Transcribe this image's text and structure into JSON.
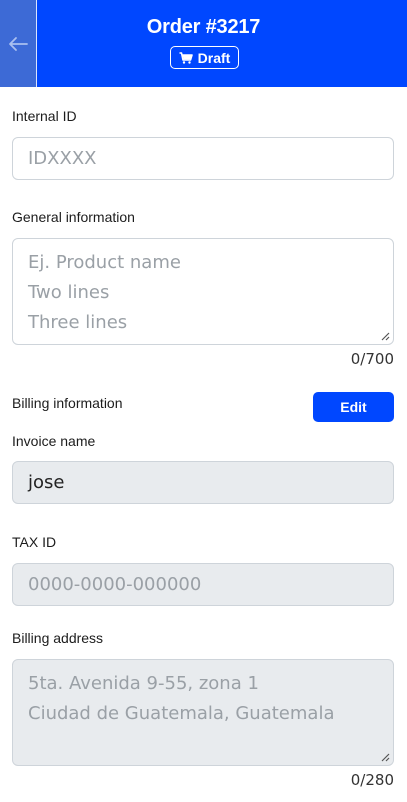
{
  "header": {
    "title": "Order #3217",
    "status_badge": "Draft",
    "back_icon": "arrow-left-icon",
    "badge_icon": "cart-icon",
    "color": "#0047ff"
  },
  "internal_id": {
    "label": "Internal ID",
    "placeholder": "IDXXXX",
    "value": ""
  },
  "general_info": {
    "label": "General information",
    "placeholder_lines": [
      "Ej. Product name",
      "Two lines",
      "Three lines"
    ],
    "counter": "0/700"
  },
  "billing": {
    "label": "Billing information",
    "edit_label": "Edit",
    "invoice_name": {
      "label": "Invoice name",
      "value": "jose"
    },
    "tax_id": {
      "label": "TAX ID",
      "placeholder": "0000-0000-000000"
    },
    "address": {
      "label": "Billing address",
      "placeholder_lines": [
        "5ta. Avenida 9-55, zona 1",
        "Ciudad de Guatemala, Guatemala"
      ],
      "counter": "0/280"
    }
  }
}
